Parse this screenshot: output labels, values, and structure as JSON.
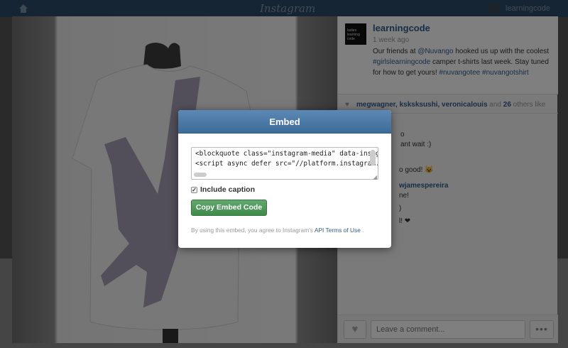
{
  "topbar": {
    "logo_text": "Instagram",
    "username": "learningcode",
    "home_icon": "home-icon"
  },
  "post": {
    "owner_avatar_text": "ladies learning code",
    "owner_name": "learningcode",
    "time_ago": "1 week ago",
    "caption_parts": {
      "p1": "Our friends at ",
      "mention": "@Nuvango",
      "p2": " hooked us up with the coolest ",
      "tag1": "#girlslearningcode",
      "p3": " camper t-shirts last week. Stay tuned for how to get yours! ",
      "tag2": "#nuvangotee",
      "tag3": "#nuvangotshirt"
    },
    "likes": {
      "names": "megwagner, ksksksushi, veronicalouis",
      "and_text": " and ",
      "count": "26",
      "others_text": " others like"
    },
    "comments": [
      {
        "text": "o"
      },
      {
        "text": "ant wait :)"
      },
      {
        "text": "o good! 😺"
      },
      {
        "text": "wjamespereira"
      },
      {
        "text": "ne!"
      },
      {
        "text": ")"
      },
      {
        "text": "l! ❤"
      }
    ],
    "comment_placeholder": "Leave a comment...",
    "more_label": "•••",
    "like_icon": "♥"
  },
  "embed_modal": {
    "title": "Embed",
    "code": "<blockquote class=\"instagram-media\" data-instgrm-ca\n<script async defer src=\"//platform.instagram.com/en_",
    "include_caption_label": "Include caption",
    "include_caption_checked": true,
    "copy_button_label": "Copy Embed Code",
    "terms_prefix": "By using this embed, you agree to Instagram's ",
    "terms_link": "API Terms of Use",
    "terms_suffix": " ."
  },
  "colors": {
    "header_blue": "#4a78a5",
    "button_green": "#4a9957",
    "link_blue": "#2f5d8c"
  }
}
